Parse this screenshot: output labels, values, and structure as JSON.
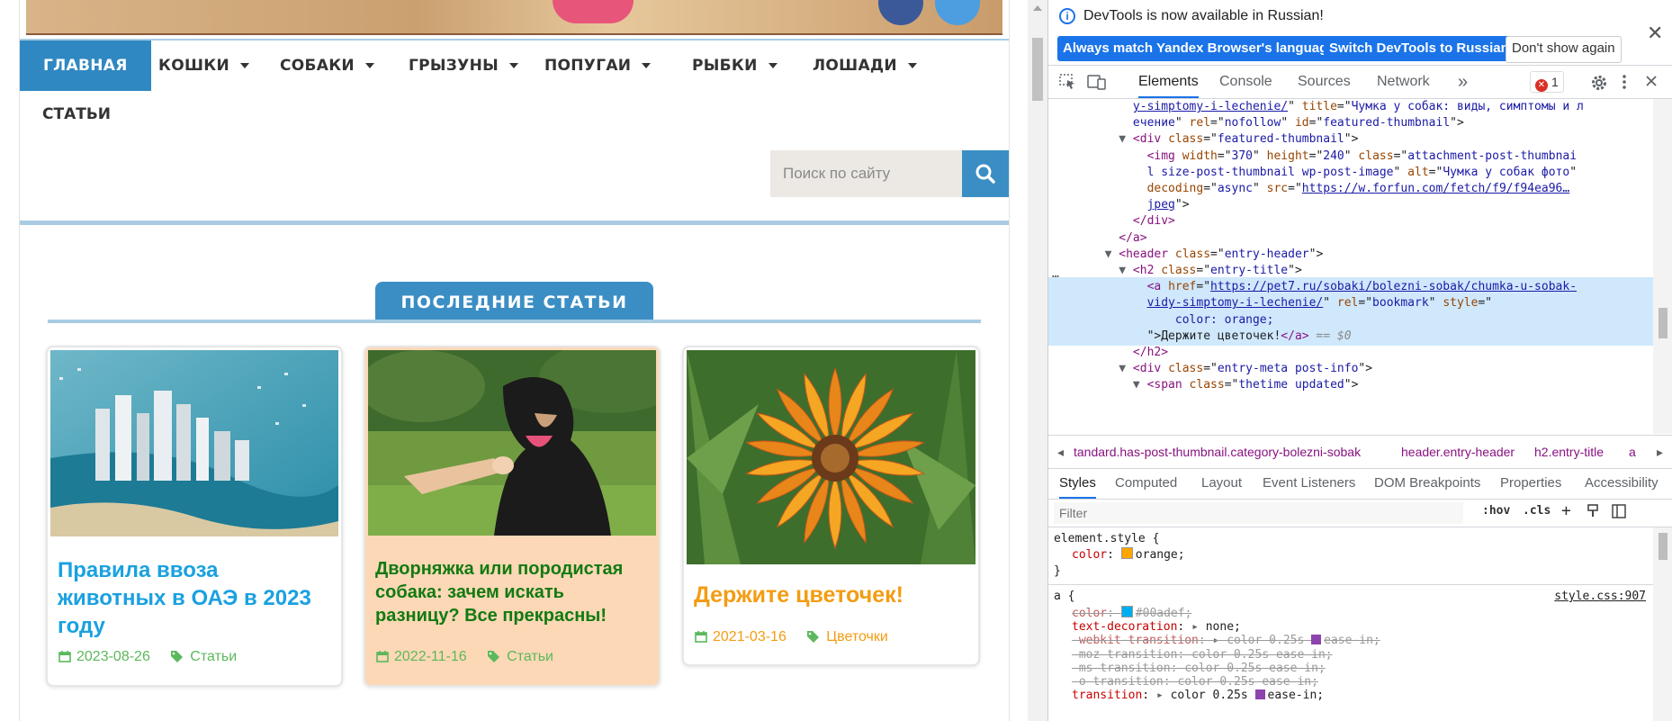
{
  "site": {
    "nav": {
      "home": "ГЛАВНАЯ",
      "cats": "КОШКИ",
      "dogs": "СОБАКИ",
      "rodents": "ГРЫЗУНЫ",
      "parrots": "ПОПУГАИ",
      "fish": "РЫБКИ",
      "horses": "ЛОШАДИ",
      "articles": "СТАТЬИ"
    },
    "search": {
      "placeholder": "Поиск по сайту"
    },
    "section_title": "ПОСЛЕДНИЕ СТАТЬИ",
    "cards": [
      {
        "title": "Правила ввоза животных в ОАЭ в 2023 году",
        "date": "2023-08-26",
        "category": "Статьи",
        "title_color": "#1aa1e0",
        "meta_color": "#5cb85c",
        "bg": "#ffffff"
      },
      {
        "title": "Дворняжка или породистая собака: зачем искать разницу? Все прекрасны!",
        "date": "2022-11-16",
        "category": "Статьи",
        "title_color": "#127a12",
        "meta_color": "#5cb85c",
        "bg": "#fdd8b6"
      },
      {
        "title": "Держите цветочек!",
        "date": "2021-03-16",
        "category": "Цветочки",
        "title_color": "#f39c12",
        "meta_color": "#f39c12",
        "bg": "#ffffff"
      }
    ]
  },
  "devtools": {
    "infobar": {
      "message": "DevTools is now available in Russian!",
      "btn_match": "Always match Yandex Browser's language",
      "btn_switch": "Switch DevTools to Russian",
      "btn_dismiss": "Don't show again"
    },
    "tabs": {
      "elements": "Elements",
      "console": "Console",
      "sources": "Sources",
      "network": "Network",
      "more": "»"
    },
    "error_count": "1",
    "dom": [
      {
        "pre": "            ",
        "parts": [
          [
            "lk",
            "y-simptomy-i-lechenie/"
          ],
          [
            "tx",
            "\" "
          ],
          [
            "an",
            "title"
          ],
          [
            "tx",
            "=\""
          ],
          [
            "av",
            "Чумка у собак: виды, симптомы и л"
          ]
        ]
      },
      {
        "pre": "            ",
        "parts": [
          [
            "av",
            "ечение"
          ],
          [
            "tx",
            "\" "
          ],
          [
            "an",
            "rel"
          ],
          [
            "tx",
            "=\""
          ],
          [
            "av",
            "nofollow"
          ],
          [
            "tx",
            "\" "
          ],
          [
            "an",
            "id"
          ],
          [
            "tx",
            "=\""
          ],
          [
            "av",
            "featured-thumbnail"
          ],
          [
            "tx",
            "\">"
          ]
        ]
      },
      {
        "pre": "          ▼ ",
        "parts": [
          [
            "tag",
            "<div "
          ],
          [
            "an",
            "class"
          ],
          [
            "tx",
            "=\""
          ],
          [
            "av",
            "featured-thumbnail"
          ],
          [
            "tx",
            "\">"
          ]
        ]
      },
      {
        "pre": "              ",
        "parts": [
          [
            "tag",
            "<img "
          ],
          [
            "an",
            "width"
          ],
          [
            "tx",
            "=\""
          ],
          [
            "av",
            "370"
          ],
          [
            "tx",
            "\" "
          ],
          [
            "an",
            "height"
          ],
          [
            "tx",
            "=\""
          ],
          [
            "av",
            "240"
          ],
          [
            "tx",
            "\" "
          ],
          [
            "an",
            "class"
          ],
          [
            "tx",
            "=\""
          ],
          [
            "av",
            "attachment-post-thumbnai"
          ]
        ]
      },
      {
        "pre": "              ",
        "parts": [
          [
            "av",
            "l size-post-thumbnail wp-post-image"
          ],
          [
            "tx",
            "\" "
          ],
          [
            "an",
            "alt"
          ],
          [
            "tx",
            "=\""
          ],
          [
            "av",
            "Чумка у собак фото"
          ],
          [
            "tx",
            "\""
          ]
        ]
      },
      {
        "pre": "              ",
        "parts": [
          [
            "an",
            "decoding"
          ],
          [
            "tx",
            "=\""
          ],
          [
            "av",
            "async"
          ],
          [
            "tx",
            "\" "
          ],
          [
            "an",
            "src"
          ],
          [
            "tx",
            "=\""
          ],
          [
            "lk",
            "https://w.forfun.com/fetch/f9/f94ea96…"
          ]
        ]
      },
      {
        "pre": "              ",
        "parts": [
          [
            "lk",
            "jpeg"
          ],
          [
            "tx",
            "\">"
          ]
        ]
      },
      {
        "pre": "            ",
        "parts": [
          [
            "tag",
            "</div>"
          ]
        ]
      },
      {
        "pre": "          ",
        "parts": [
          [
            "tag",
            "</a>"
          ]
        ]
      },
      {
        "pre": "        ▼ ",
        "parts": [
          [
            "tag",
            "<header "
          ],
          [
            "an",
            "class"
          ],
          [
            "tx",
            "=\""
          ],
          [
            "av",
            "entry-header"
          ],
          [
            "tx",
            "\">"
          ]
        ]
      },
      {
        "pre": "          ▼ ",
        "parts": [
          [
            "tag",
            "<h2 "
          ],
          [
            "an",
            "class"
          ],
          [
            "tx",
            "=\""
          ],
          [
            "av",
            "entry-title"
          ],
          [
            "tx",
            "\">"
          ]
        ]
      },
      {
        "pre": "              ",
        "sel": true,
        "parts": [
          [
            "tag",
            "<a "
          ],
          [
            "an",
            "href"
          ],
          [
            "tx",
            "=\""
          ],
          [
            "lk",
            "https://pet7.ru/sobaki/bolezni-sobak/chumka-u-sobak-"
          ]
        ]
      },
      {
        "pre": "              ",
        "sel": true,
        "parts": [
          [
            "lk",
            "vidy-simptomy-i-lechenie/"
          ],
          [
            "tx",
            "\" "
          ],
          [
            "an",
            "rel"
          ],
          [
            "tx",
            "=\""
          ],
          [
            "av",
            "bookmark"
          ],
          [
            "tx",
            "\" "
          ],
          [
            "an",
            "style"
          ],
          [
            "tx",
            "=\""
          ]
        ]
      },
      {
        "pre": "                  ",
        "sel": true,
        "parts": [
          [
            "av",
            "color: orange;"
          ]
        ]
      },
      {
        "pre": "              ",
        "sel": true,
        "parts": [
          [
            "tx",
            "\">"
          ],
          [
            "tx",
            "Держите цветочек!"
          ],
          [
            "tag",
            "</a>"
          ],
          [
            "gr",
            " == $0"
          ]
        ]
      },
      {
        "pre": "            ",
        "parts": [
          [
            "tag",
            "</h2>"
          ]
        ]
      },
      {
        "pre": "          ▼ ",
        "parts": [
          [
            "tag",
            "<div "
          ],
          [
            "an",
            "class"
          ],
          [
            "tx",
            "=\""
          ],
          [
            "av",
            "entry-meta post-info"
          ],
          [
            "tx",
            "\">"
          ]
        ]
      },
      {
        "pre": "            ▼ ",
        "parts": [
          [
            "tag",
            "<span "
          ],
          [
            "an",
            "class"
          ],
          [
            "tx",
            "=\""
          ],
          [
            "av",
            "thetime updated"
          ],
          [
            "tx",
            "\">"
          ]
        ]
      }
    ],
    "breadcrumbs": [
      "tandard.has-post-thumbnail.category-bolezni-sobak",
      "header.entry-header",
      "h2.entry-title",
      "a"
    ],
    "subtabs": {
      "styles": "Styles",
      "computed": "Computed",
      "layout": "Layout",
      "listeners": "Event Listeners",
      "dom_bp": "DOM Breakpoints",
      "properties": "Properties",
      "accessibility": "Accessibility"
    },
    "filter": {
      "placeholder": "Filter",
      "hov": ":hov",
      "cls": ".cls"
    },
    "styles": {
      "element_style_selector": "element.style {",
      "element_style_prop": "color",
      "element_style_value": "orange;",
      "element_style_swatch": "#ffa500",
      "a_selector": "a {",
      "a_source": "style.css:907",
      "a_rules": [
        {
          "prop": "color",
          "value": "#00adef;",
          "swatch": "#00adef",
          "struck": true
        },
        {
          "prop": "text-decoration",
          "value": "none;",
          "arrow": true,
          "struck": false
        },
        {
          "prop": "-webkit-transition",
          "value": "color 0.25s",
          "value2": "ease-in;",
          "arrow": true,
          "ease": true,
          "struck": true
        },
        {
          "prop": "-moz-transition",
          "value": "color 0.25s ease-in;",
          "struck": true,
          "prop_gray": true
        },
        {
          "prop": "-ms-transition",
          "value": "color 0.25s ease-in;",
          "struck": true,
          "prop_gray": true
        },
        {
          "prop": "-o-transition",
          "value": "color 0.25s ease-in;",
          "struck": true,
          "prop_gray": true
        },
        {
          "prop": "transition",
          "value": "color 0.25s",
          "value2": "ease-in;",
          "arrow": true,
          "ease": true,
          "struck": false
        }
      ]
    }
  }
}
